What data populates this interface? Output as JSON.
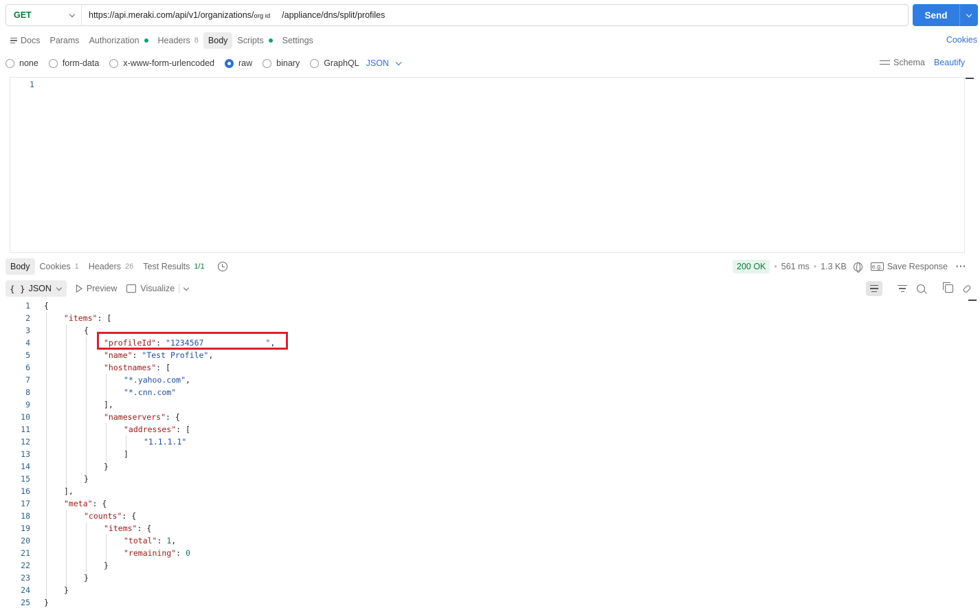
{
  "request": {
    "method": "GET",
    "url_prefix": "https://api.meraki.com/api/v1/organizations/",
    "url_orgid": "org id",
    "url_suffix": "/appliance/dns/split/profiles",
    "send_label": "Send"
  },
  "request_tabs": {
    "docs": "Docs",
    "params": "Params",
    "authorization": "Authorization",
    "headers": "Headers",
    "headers_count": "8",
    "body": "Body",
    "scripts": "Scripts",
    "settings": "Settings",
    "cookies": "Cookies"
  },
  "body_types": {
    "none": "none",
    "form_data": "form-data",
    "urlencoded": "x-www-form-urlencoded",
    "raw": "raw",
    "binary": "binary",
    "graphql": "GraphQL",
    "language": "JSON",
    "schema": "Schema",
    "beautify": "Beautify",
    "selected": "raw"
  },
  "editor": {
    "line_numbers": [
      "1"
    ]
  },
  "response_tabs": {
    "body": "Body",
    "cookies": "Cookies",
    "cookies_count": "1",
    "headers": "Headers",
    "headers_count": "26",
    "test_results": "Test Results",
    "test_results_count": "1/1"
  },
  "response_status": {
    "status": "200 OK",
    "time": "561 ms",
    "size": "1.3 KB",
    "save_response": "Save Response"
  },
  "response_toolbar": {
    "format_glyph": "{ }",
    "format": "JSON",
    "preview": "Preview",
    "visualize": "Visualize"
  },
  "response_lines": [
    {
      "n": "1",
      "i": 0,
      "parts": [
        [
          "p",
          "{"
        ]
      ]
    },
    {
      "n": "2",
      "i": 1,
      "parts": [
        [
          "k",
          "\"items\""
        ],
        [
          "p",
          ": ["
        ]
      ]
    },
    {
      "n": "3",
      "i": 2,
      "parts": [
        [
          "p",
          "{"
        ]
      ]
    },
    {
      "n": "4",
      "i": 3,
      "parts": [
        [
          "k",
          "\"profileId\""
        ],
        [
          "p",
          ": "
        ],
        [
          "s",
          "\"1234567             \""
        ],
        [
          "p",
          ","
        ]
      ]
    },
    {
      "n": "5",
      "i": 3,
      "parts": [
        [
          "k",
          "\"name\""
        ],
        [
          "p",
          ": "
        ],
        [
          "s",
          "\"Test Profile\""
        ],
        [
          "p",
          ","
        ]
      ]
    },
    {
      "n": "6",
      "i": 3,
      "parts": [
        [
          "k",
          "\"hostnames\""
        ],
        [
          "p",
          ": ["
        ]
      ]
    },
    {
      "n": "7",
      "i": 4,
      "parts": [
        [
          "s",
          "\"*.yahoo.com\""
        ],
        [
          "p",
          ","
        ]
      ]
    },
    {
      "n": "8",
      "i": 4,
      "parts": [
        [
          "s",
          "\"*.cnn.com\""
        ]
      ]
    },
    {
      "n": "9",
      "i": 3,
      "parts": [
        [
          "p",
          "],"
        ]
      ]
    },
    {
      "n": "10",
      "i": 3,
      "parts": [
        [
          "k",
          "\"nameservers\""
        ],
        [
          "p",
          ": {"
        ]
      ]
    },
    {
      "n": "11",
      "i": 4,
      "parts": [
        [
          "k",
          "\"addresses\""
        ],
        [
          "p",
          ": ["
        ]
      ]
    },
    {
      "n": "12",
      "i": 5,
      "parts": [
        [
          "s",
          "\"1.1.1.1\""
        ]
      ]
    },
    {
      "n": "13",
      "i": 4,
      "parts": [
        [
          "p",
          "]"
        ]
      ]
    },
    {
      "n": "14",
      "i": 3,
      "parts": [
        [
          "p",
          "}"
        ]
      ]
    },
    {
      "n": "15",
      "i": 2,
      "parts": [
        [
          "p",
          "}"
        ]
      ]
    },
    {
      "n": "16",
      "i": 1,
      "parts": [
        [
          "p",
          "],"
        ]
      ]
    },
    {
      "n": "17",
      "i": 1,
      "parts": [
        [
          "k",
          "\"meta\""
        ],
        [
          "p",
          ": {"
        ]
      ]
    },
    {
      "n": "18",
      "i": 2,
      "parts": [
        [
          "k",
          "\"counts\""
        ],
        [
          "p",
          ": {"
        ]
      ]
    },
    {
      "n": "19",
      "i": 3,
      "parts": [
        [
          "k",
          "\"items\""
        ],
        [
          "p",
          ": {"
        ]
      ]
    },
    {
      "n": "20",
      "i": 4,
      "parts": [
        [
          "k",
          "\"total\""
        ],
        [
          "p",
          ": "
        ],
        [
          "n",
          "1"
        ],
        [
          "p",
          ","
        ]
      ]
    },
    {
      "n": "21",
      "i": 4,
      "parts": [
        [
          "k",
          "\"remaining\""
        ],
        [
          "p",
          ": "
        ],
        [
          "n",
          "0"
        ]
      ]
    },
    {
      "n": "22",
      "i": 3,
      "parts": [
        [
          "p",
          "}"
        ]
      ]
    },
    {
      "n": "23",
      "i": 2,
      "parts": [
        [
          "p",
          "}"
        ]
      ]
    },
    {
      "n": "24",
      "i": 1,
      "parts": [
        [
          "p",
          "}"
        ]
      ]
    },
    {
      "n": "25",
      "i": 0,
      "parts": [
        [
          "p",
          "}"
        ]
      ]
    }
  ],
  "colors": {
    "accent": "#2f7de1",
    "method_get": "#0b7a3b",
    "status_ok_bg": "#e6f5ec",
    "highlight_box": "#dd1f2c",
    "json_key": "#a11818",
    "json_string": "#1f4ea3"
  },
  "icons": [
    "docs-icon",
    "chevron-down-icon",
    "schema-icon",
    "history-icon",
    "globe-icon",
    "save-response-icon",
    "more-icon",
    "play-icon",
    "image-icon",
    "wrap-lines-icon",
    "filter-icon",
    "search-icon",
    "copy-icon",
    "link-icon"
  ]
}
